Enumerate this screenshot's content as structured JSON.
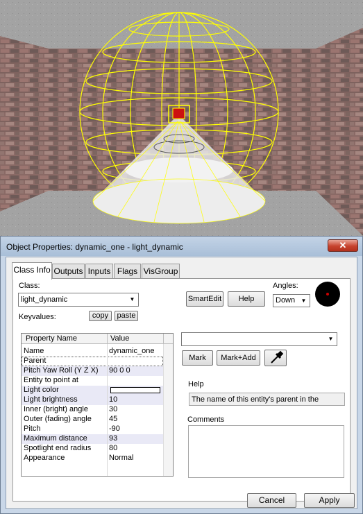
{
  "dialog": {
    "title": "Object Properties: dynamic_one - light_dynamic",
    "close_glyph": "✕"
  },
  "tabs": [
    {
      "label": "Class Info",
      "active": true
    },
    {
      "label": "Outputs",
      "active": false
    },
    {
      "label": "Inputs",
      "active": false
    },
    {
      "label": "Flags",
      "active": false
    },
    {
      "label": "VisGroup",
      "active": false
    }
  ],
  "class_info": {
    "class_label": "Class:",
    "class_value": "light_dynamic",
    "keyvalues_label": "Keyvalues:",
    "copy_label": "copy",
    "paste_label": "paste",
    "smartedit_label": "SmartEdit",
    "help_label": "Help",
    "angles_label": "Angles:",
    "angles_value": "Down"
  },
  "property_grid": {
    "headers": [
      "Property Name",
      "Value"
    ],
    "rows": [
      {
        "name": "Name",
        "value": ""
      },
      {
        "name": "Parent",
        "value": ""
      },
      {
        "name": "Pitch Yaw Roll (Y Z X)",
        "value": "90 0 0"
      },
      {
        "name": "Entity to point at",
        "value": ""
      },
      {
        "name": "Light color",
        "value": ""
      },
      {
        "name": "Light brightness",
        "value": "10"
      },
      {
        "name": "Inner (bright) angle",
        "value": "30"
      },
      {
        "name": "Outer (fading) angle",
        "value": "45"
      },
      {
        "name": "Pitch",
        "value": "-90"
      },
      {
        "name": "Maximum distance",
        "value": "93"
      },
      {
        "name": "Spotlight end radius",
        "value": "80"
      },
      {
        "name": "Appearance",
        "value": "Normal"
      }
    ],
    "name_row_value": "dynamic_one"
  },
  "right_panel": {
    "value_combo": "",
    "mark_label": "Mark",
    "mark_add_label": "Mark+Add",
    "help_heading": "Help",
    "help_text": "The name of this entity's parent in the",
    "comments_heading": "Comments",
    "comments_text": ""
  },
  "footer": {
    "cancel_label": "Cancel",
    "apply_label": "Apply"
  },
  "colors": {
    "selection_yellow": "#ffff00",
    "alt_row": "#e9e9f6",
    "light_entity_red": "#cc1111"
  },
  "icons": {
    "eyedropper": "eyedropper-icon",
    "angle_dial": "angle-dial-icon",
    "close": "close-icon"
  }
}
